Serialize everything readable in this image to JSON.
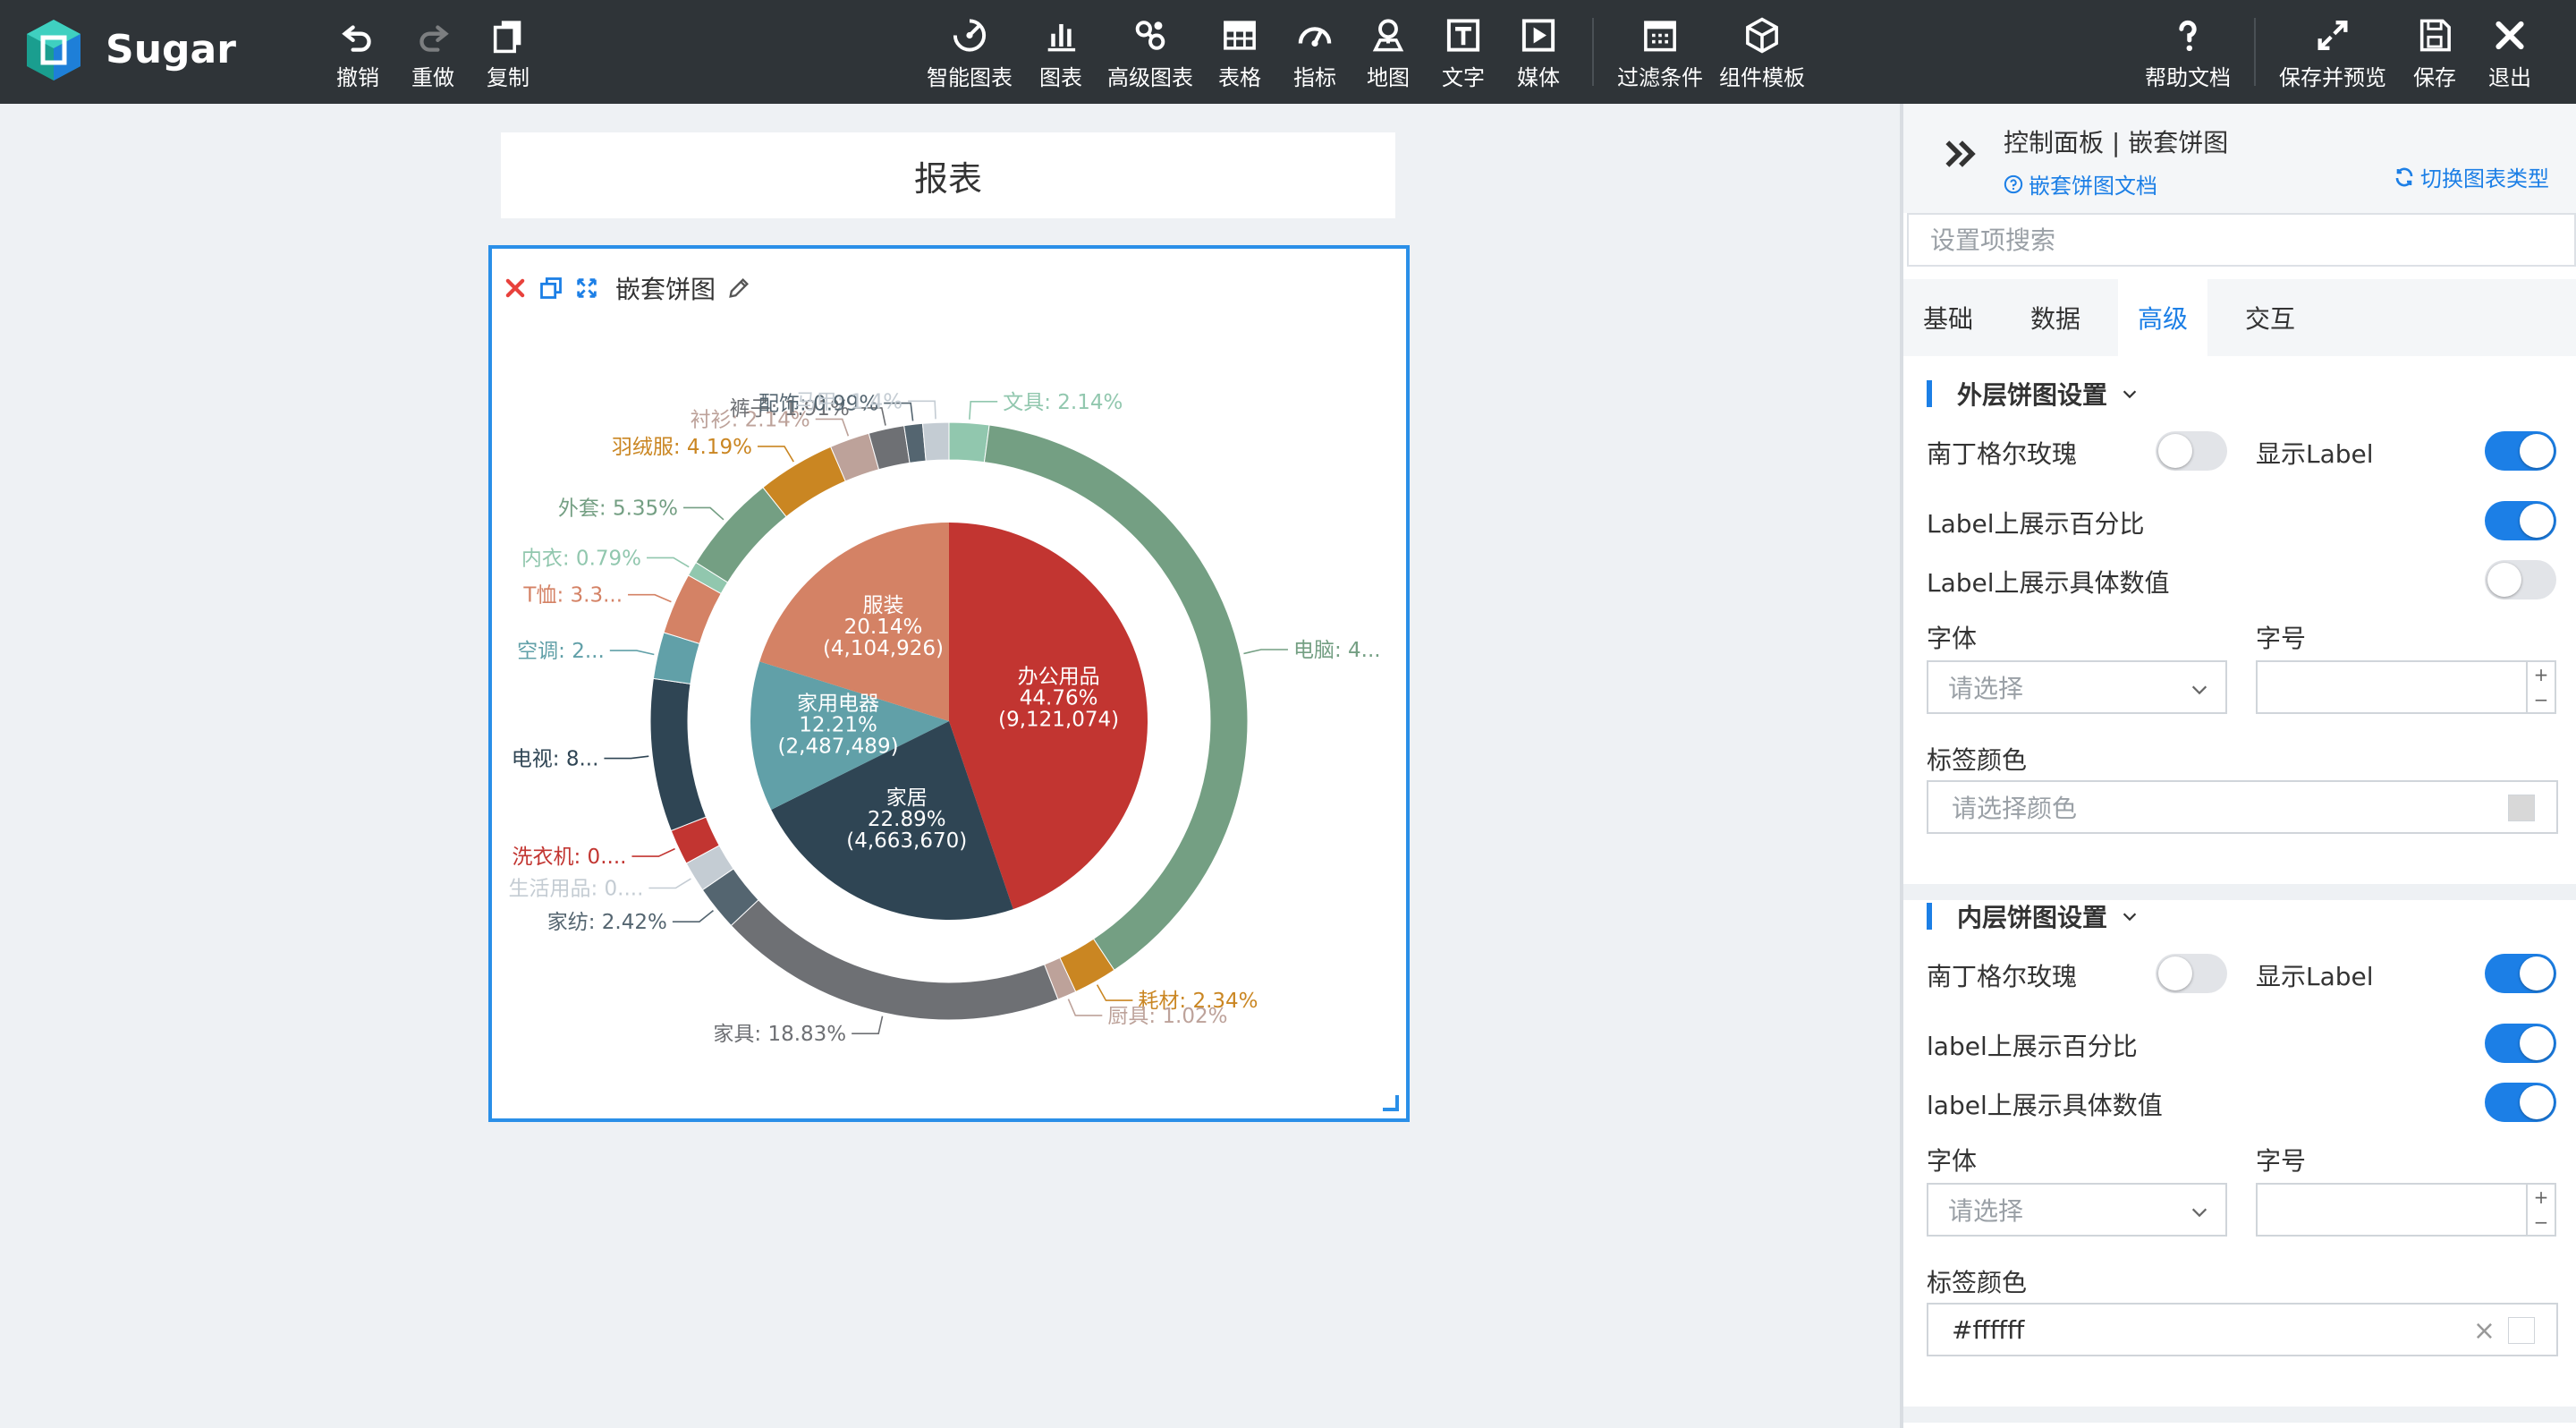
{
  "toolbar": {
    "brand": "Sugar",
    "undo": "撤销",
    "redo": "重做",
    "copy": "复制",
    "smart_chart": "智能图表",
    "chart": "图表",
    "advanced_chart": "高级图表",
    "table": "表格",
    "indicator": "指标",
    "map": "地图",
    "text": "文字",
    "media": "媒体",
    "filter": "过滤条件",
    "component_template": "组件模板",
    "help": "帮助文档",
    "save_preview": "保存并预览",
    "save": "保存",
    "exit": "退出"
  },
  "report": {
    "title": "报表"
  },
  "chart_box": {
    "name": "嵌套饼图"
  },
  "chart_data": {
    "type": "pie",
    "inner": [
      {
        "name": "办公用品",
        "percent": "44.76%",
        "value": 9121074,
        "value_label": "(9,121,074)",
        "color": "#c23531"
      },
      {
        "name": "家居",
        "percent": "22.89%",
        "value": 4663670,
        "value_label": "(4,663,670)",
        "color": "#2f4554"
      },
      {
        "name": "家用电器",
        "percent": "12.21%",
        "value": 2487489,
        "value_label": "(2,487,489)",
        "color": "#61a0a8"
      },
      {
        "name": "服装",
        "percent": "20.14%",
        "value": 4104926,
        "value_label": "(4,104,926)",
        "color": "#d48265"
      }
    ],
    "outer": [
      {
        "label": "文具: 2.14%",
        "value": 2.14,
        "color": "#91c7ae"
      },
      {
        "label": "电脑: 4...",
        "value": 38.26,
        "color": "#749f83"
      },
      {
        "label": "耗材: 2.34%",
        "value": 2.34,
        "color": "#ca8622"
      },
      {
        "label": "厨具: 1.02%",
        "value": 1.02,
        "color": "#bda29a"
      },
      {
        "label": "家具: 18.83%",
        "value": 18.83,
        "color": "#6e7074"
      },
      {
        "label": "家纺: 2.42%",
        "value": 2.42,
        "color": "#546570"
      },
      {
        "label": "生活用品: 0....",
        "value": 1.65,
        "color": "#c4ccd3"
      },
      {
        "label": "洗衣机: 0....",
        "value": 1.9,
        "color": "#c23531"
      },
      {
        "label": "电视: 8...",
        "value": 8.2,
        "color": "#2f4554"
      },
      {
        "label": "空调: 2...",
        "value": 2.5,
        "color": "#61a0a8"
      },
      {
        "label": "T恤: 3.3...",
        "value": 3.3,
        "color": "#d48265"
      },
      {
        "label": "内衣: 0.79%",
        "value": 0.79,
        "color": "#91c7ae"
      },
      {
        "label": "外套: 5.35%",
        "value": 5.35,
        "color": "#749f83"
      },
      {
        "label": "羽绒服: 4.19%",
        "value": 4.19,
        "color": "#ca8622"
      },
      {
        "label": "衬衫: 2.14%",
        "value": 2.14,
        "color": "#bda29a"
      },
      {
        "label": "裤子: 1.91%",
        "value": 1.91,
        "color": "#6e7074"
      },
      {
        "label": "配饰: 0.99%",
        "value": 0.99,
        "color": "#546570"
      },
      {
        "label": "马甲: 1.4%",
        "value": 1.4,
        "color": "#c4ccd3"
      }
    ]
  },
  "panel": {
    "title": "控制面板 | 嵌套饼图",
    "doc_link": "嵌套饼图文档",
    "switch_type": "切换图表类型",
    "search_placeholder": "设置项搜索",
    "tabs": [
      "基础",
      "数据",
      "高级",
      "交互"
    ],
    "active_tab": "高级",
    "outer": {
      "title": "外层饼图设置",
      "nightingale": "南丁格尔玫瑰",
      "nightingale_on": false,
      "show_label": "显示Label",
      "show_label_on": true,
      "show_percent": "Label上展示百分比",
      "show_percent_on": true,
      "show_value": "Label上展示具体数值",
      "show_value_on": false,
      "font_label": "字体",
      "font_placeholder": "请选择",
      "size_label": "字号",
      "color_label": "标签颜色",
      "color_placeholder": "请选择颜色"
    },
    "inner": {
      "title": "内层饼图设置",
      "nightingale": "南丁格尔玫瑰",
      "nightingale_on": false,
      "show_label": "显示Label",
      "show_label_on": true,
      "show_percent": "label上展示百分比",
      "show_percent_on": true,
      "show_value": "label上展示具体数值",
      "show_value_on": true,
      "font_label": "字体",
      "font_placeholder": "请选择",
      "size_label": "字号",
      "color_label": "标签颜色",
      "color_value": "#ffffff"
    }
  }
}
